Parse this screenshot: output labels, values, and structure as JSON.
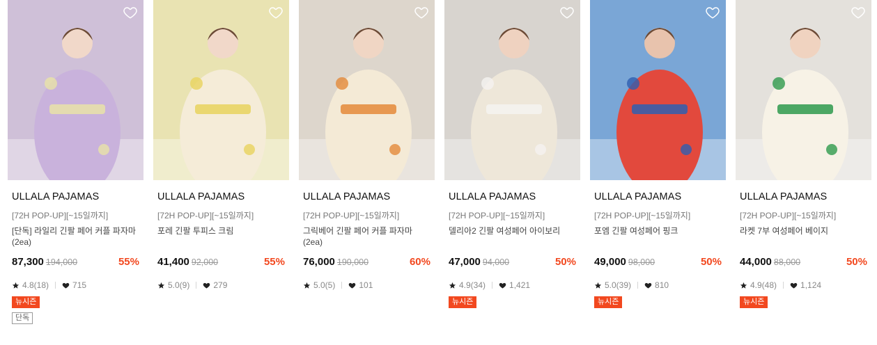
{
  "products": [
    {
      "brand": "ULLALA PAJAMAS",
      "promo": "[72H POP-UP][~15일까지]",
      "name": "[단독] 라일리 긴팔 페어 커플 파자마(2ea)",
      "price": "87,300",
      "original_price": "194,000",
      "discount": "55%",
      "rating": "4.8(18)",
      "likes": "715",
      "badges": [
        "뉴시즌",
        "단독"
      ],
      "image": {
        "bg": "#cfc0d8",
        "outfit": "#c9b2dc",
        "accent": "#e9e2a8",
        "skin": "#f1d8c9"
      }
    },
    {
      "brand": "ULLALA PAJAMAS",
      "promo": "[72H POP-UP][~15일까지]",
      "name": "포레 긴팔 투피스 크림",
      "price": "41,400",
      "original_price": "92,000",
      "discount": "55%",
      "rating": "5.0(9)",
      "likes": "279",
      "badges": [],
      "image": {
        "bg": "#e9e3b2",
        "outfit": "#f5ecd8",
        "accent": "#e8d35e",
        "skin": "#f1d8c9"
      }
    },
    {
      "brand": "ULLALA PAJAMAS",
      "promo": "[72H POP-UP][~15일까지]",
      "name": "그릭베어 긴팔 페어 커플 파자마(2ea)",
      "price": "76,000",
      "original_price": "190,000",
      "discount": "60%",
      "rating": "5.0(5)",
      "likes": "101",
      "badges": [],
      "image": {
        "bg": "#ddd6cc",
        "outfit": "#f4ead6",
        "accent": "#e48a3a",
        "skin": "#f0d6c4"
      }
    },
    {
      "brand": "ULLALA PAJAMAS",
      "promo": "[72H POP-UP][~15일까지]",
      "name": "델리아2 긴팔 여성페어 아이보리",
      "price": "47,000",
      "original_price": "94,000",
      "discount": "50%",
      "rating": "4.9(34)",
      "likes": "1,421",
      "badges": [
        "뉴시즌"
      ],
      "image": {
        "bg": "#d8d4cf",
        "outfit": "#eee7d9",
        "accent": "#f5f3f0",
        "skin": "#efd2c0"
      }
    },
    {
      "brand": "ULLALA PAJAMAS",
      "promo": "[72H POP-UP][~15일까지]",
      "name": "포엠 긴팔 여성페어 핑크",
      "price": "49,000",
      "original_price": "98,000",
      "discount": "50%",
      "rating": "5.0(39)",
      "likes": "810",
      "badges": [
        "뉴시즌"
      ],
      "image": {
        "bg": "#7aa6d6",
        "outfit": "#e2493d",
        "accent": "#2f5fb0",
        "skin": "#e8c3ad"
      }
    },
    {
      "brand": "ULLALA PAJAMAS",
      "promo": "[72H POP-UP][~15일까지]",
      "name": "라켓 7부 여성페어 베이지",
      "price": "44,000",
      "original_price": "88,000",
      "discount": "50%",
      "rating": "4.9(48)",
      "likes": "1,124",
      "badges": [
        "뉴시즌"
      ],
      "image": {
        "bg": "#e4e1dc",
        "outfit": "#f7f2e6",
        "accent": "#2e9a4c",
        "skin": "#f0d3c0"
      }
    }
  ],
  "colors": {
    "discount": "#f2481f",
    "badge_new": "#f2481f"
  },
  "icons": {
    "wishlist": "heart-outline-icon",
    "rating": "star-icon",
    "likes": "heart-filled-icon"
  }
}
